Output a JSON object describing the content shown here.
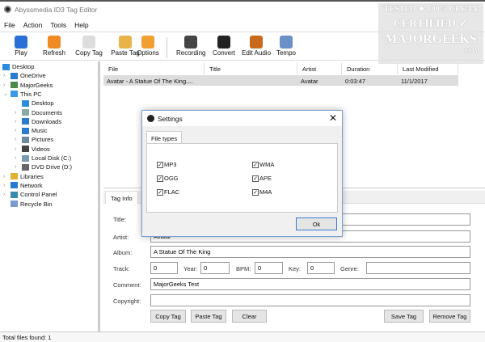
{
  "window": {
    "title": "Abyssmedia ID3 Tag Editor"
  },
  "menu": [
    "File",
    "Action",
    "Tools",
    "Help"
  ],
  "toolbar": [
    {
      "label": "Play",
      "icon": "play-icon",
      "color": "#2a6fd6"
    },
    {
      "label": "Refresh",
      "icon": "refresh-icon",
      "color": "#f08a24"
    },
    {
      "label": "Copy Tag",
      "icon": "copy-icon",
      "color": "#ddd"
    },
    {
      "label": "Paste Tag",
      "icon": "paste-icon",
      "color": "#e8b44a"
    },
    {
      "label": "Options",
      "icon": "wrench-icon",
      "color": "#f0a030"
    },
    {
      "label": "Recording",
      "icon": "microphone-icon",
      "color": "#444"
    },
    {
      "label": "Convert",
      "icon": "convert-icon",
      "color": "#222"
    },
    {
      "label": "Edit Audio",
      "icon": "edit-audio-icon",
      "color": "#c86a1a"
    },
    {
      "label": "Tempo",
      "icon": "tempo-icon",
      "color": "#6b8fc7"
    }
  ],
  "tree": [
    {
      "label": "Desktop",
      "icon": "desktop-icon",
      "color": "#2b8be0"
    },
    {
      "label": "OneDrive",
      "icon": "cloud-icon",
      "color": "#2a7ad0"
    },
    {
      "label": "MajorGeeks",
      "icon": "user-icon",
      "color": "#4a8a4a"
    },
    {
      "label": "This PC",
      "icon": "computer-icon",
      "color": "#3a9ae8"
    },
    {
      "label": "Desktop",
      "icon": "desktop-icon",
      "color": "#2b8be0"
    },
    {
      "label": "Documents",
      "icon": "documents-icon",
      "color": "#8aa"
    },
    {
      "label": "Downloads",
      "icon": "downloads-icon",
      "color": "#2a7ad0"
    },
    {
      "label": "Music",
      "icon": "music-icon",
      "color": "#2a7ad0"
    },
    {
      "label": "Pictures",
      "icon": "pictures-icon",
      "color": "#6a8aa0"
    },
    {
      "label": "Videos",
      "icon": "videos-icon",
      "color": "#444"
    },
    {
      "label": "Local Disk (C:)",
      "icon": "disk-icon",
      "color": "#7a9ab0"
    },
    {
      "label": "DVD Drive (D:)",
      "icon": "dvd-icon",
      "color": "#666"
    },
    {
      "label": "Libraries",
      "icon": "libraries-icon",
      "color": "#e0b030"
    },
    {
      "label": "Network",
      "icon": "network-icon",
      "color": "#2a7ad0"
    },
    {
      "label": "Control Panel",
      "icon": "control-panel-icon",
      "color": "#3a8ab0"
    },
    {
      "label": "Recycle Bin",
      "icon": "recycle-bin-icon",
      "color": "#7a9ad0"
    }
  ],
  "table": {
    "columns": [
      "File",
      "Title",
      "Artist",
      "Duration",
      "Last Modified"
    ],
    "rows": [
      [
        "Avatar - A Statue Of The King....",
        "",
        "Avatar",
        "0:03:47",
        "11/1/2017"
      ]
    ]
  },
  "taginfo": {
    "tab": "Tag Info",
    "labels": {
      "title": "Title:",
      "artist": "Artist:",
      "album": "Album:",
      "track": "Track:",
      "year": "Year:",
      "bpm": "BPM:",
      "key": "Key:",
      "genre": "Genre:",
      "comment": "Comment:",
      "copyright": "Copyright:"
    },
    "values": {
      "title": "",
      "artist": "Avatar",
      "album": "A Statue Of The King",
      "track": "0",
      "year": "0",
      "bpm": "0",
      "key": "0",
      "genre": "",
      "comment": "MajorGeeks Test",
      "copyright": ""
    },
    "buttons": {
      "copy": "Copy Tag",
      "paste": "Paste Tag",
      "clear": "Clear",
      "save": "Save Tag",
      "remove": "Remove Tag"
    }
  },
  "status": "Total files found: 1",
  "dialog": {
    "title": "Settings",
    "tab": "File types",
    "ok": "Ok",
    "types": [
      {
        "label": "MP3",
        "checked": true
      },
      {
        "label": "WMA",
        "checked": true
      },
      {
        "label": "OGG",
        "checked": true
      },
      {
        "label": "APE",
        "checked": true
      },
      {
        "label": "FLAC",
        "checked": true
      },
      {
        "label": "M4A",
        "checked": true
      }
    ]
  },
  "watermark": {
    "line1": "TESTED • 100% CLEAN",
    "line2": "CERTIFIED",
    "line3": "MAJORGEEKS",
    ".com": ".COM"
  }
}
